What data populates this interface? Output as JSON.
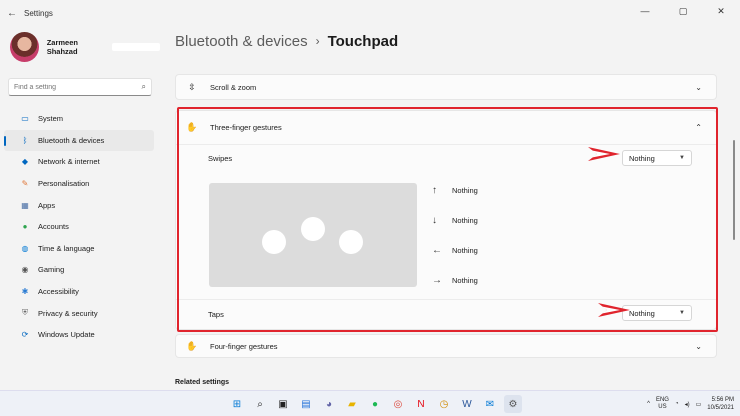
{
  "window": {
    "title": "Settings",
    "back_glyph": "←",
    "minimize": "—",
    "maximize": "▢",
    "close": "✕"
  },
  "profile": {
    "name": "Zarmeen Shahzad"
  },
  "search": {
    "placeholder": "Find a setting",
    "icon": "search-icon"
  },
  "nav": [
    {
      "label": "System",
      "icon": "system-icon",
      "glyph": "▭",
      "color": "#0067c0",
      "active": false
    },
    {
      "label": "Bluetooth & devices",
      "icon": "bluetooth-icon",
      "glyph": "ᛒ",
      "color": "#0067c0",
      "active": true
    },
    {
      "label": "Network & internet",
      "icon": "wifi-icon",
      "glyph": "◆",
      "color": "#0067c0",
      "active": false
    },
    {
      "label": "Personalisation",
      "icon": "brush-icon",
      "glyph": "✎",
      "color": "#e0783a",
      "active": false
    },
    {
      "label": "Apps",
      "icon": "apps-icon",
      "glyph": "▦",
      "color": "#4a6fa5",
      "active": false
    },
    {
      "label": "Accounts",
      "icon": "accounts-icon",
      "glyph": "●",
      "color": "#2ea44f",
      "active": false
    },
    {
      "label": "Time & language",
      "icon": "globe-icon",
      "glyph": "◍",
      "color": "#0078d4",
      "active": false
    },
    {
      "label": "Gaming",
      "icon": "gaming-icon",
      "glyph": "◉",
      "color": "#555555",
      "active": false
    },
    {
      "label": "Accessibility",
      "icon": "accessibility-icon",
      "glyph": "✱",
      "color": "#2b7cd3",
      "active": false
    },
    {
      "label": "Privacy & security",
      "icon": "shield-icon",
      "glyph": "⛨",
      "color": "#6b6b6b",
      "active": false
    },
    {
      "label": "Windows Update",
      "icon": "update-icon",
      "glyph": "⟳",
      "color": "#0067c0",
      "active": false
    }
  ],
  "breadcrumb": {
    "parent": "Bluetooth & devices",
    "separator": "›",
    "current": "Touchpad"
  },
  "cards": {
    "scroll_zoom": {
      "label": "Scroll & zoom",
      "icon": "scroll-icon",
      "glyph": "⇳"
    },
    "three_finger": {
      "label": "Three-finger gestures",
      "icon": "hand-icon",
      "glyph": "✋"
    },
    "four_finger": {
      "label": "Four-finger gestures",
      "icon": "hand-icon",
      "glyph": "✋"
    }
  },
  "three_finger": {
    "swipes_label": "Swipes",
    "swipes_value": "Nothing",
    "taps_label": "Taps",
    "taps_value": "Nothing",
    "gestures": [
      {
        "direction": "up",
        "glyph": "↑",
        "value": "Nothing"
      },
      {
        "direction": "down",
        "glyph": "↓",
        "value": "Nothing"
      },
      {
        "direction": "left",
        "glyph": "←",
        "value": "Nothing"
      },
      {
        "direction": "right",
        "glyph": "→",
        "value": "Nothing"
      }
    ]
  },
  "related": {
    "label": "Related settings"
  },
  "annotation_color": "#e0242d",
  "taskbar": {
    "apps": [
      {
        "name": "start-icon",
        "glyph": "⊞",
        "color": "#0078d4"
      },
      {
        "name": "search-icon",
        "glyph": "⌕",
        "color": "#222"
      },
      {
        "name": "task-view-icon",
        "glyph": "▣",
        "color": "#222"
      },
      {
        "name": "widgets-icon",
        "glyph": "▤",
        "color": "#1e6fd9"
      },
      {
        "name": "chat-icon",
        "glyph": "◕",
        "color": "#6264a7"
      },
      {
        "name": "file-explorer-icon",
        "glyph": "▰",
        "color": "#e8b400"
      },
      {
        "name": "spotify-icon",
        "glyph": "●",
        "color": "#1db954"
      },
      {
        "name": "chrome-icon",
        "glyph": "◎",
        "color": "#db4437"
      },
      {
        "name": "netflix-icon",
        "glyph": "N",
        "color": "#e50914"
      },
      {
        "name": "clock-app-icon",
        "glyph": "◷",
        "color": "#d08a00"
      },
      {
        "name": "word-icon",
        "glyph": "W",
        "color": "#2b579a"
      },
      {
        "name": "mail-icon",
        "glyph": "✉",
        "color": "#0078d4"
      },
      {
        "name": "settings-icon",
        "glyph": "⚙",
        "color": "#555"
      }
    ],
    "tray_chevron": "^",
    "lang_top": "ENG",
    "lang_bottom": "US",
    "time": "5:56 PM",
    "date": "10/5/2021"
  }
}
